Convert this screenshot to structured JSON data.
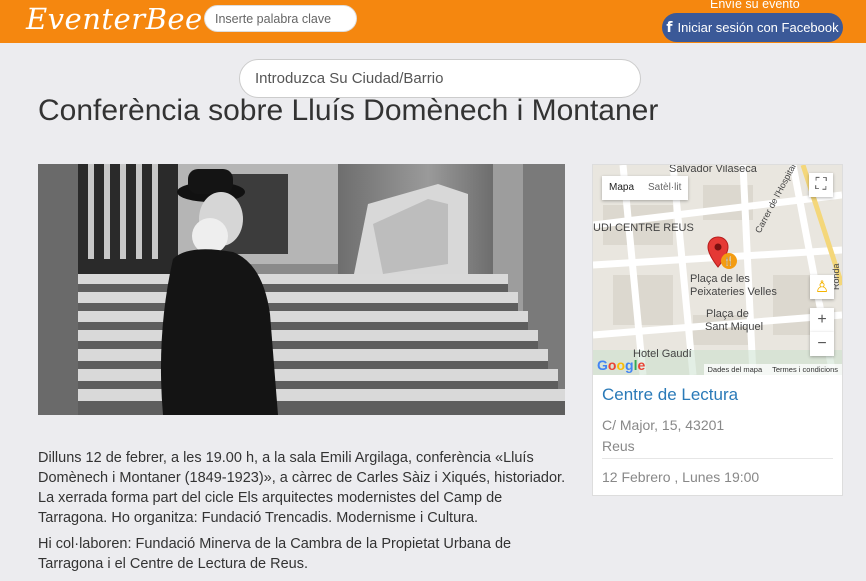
{
  "header": {
    "logo": "EventerBee",
    "keyword_placeholder": "Inserte palabra clave",
    "submit_event": "Envíe su evento",
    "facebook_login": "Iniciar sesión con Facebook",
    "facebook_icon": "f",
    "brand_color": "#f5870f",
    "facebook_color": "#3b5998"
  },
  "city_search": {
    "placeholder": "Introduzca Su Ciudad/Barrio"
  },
  "event": {
    "title": "Conferència sobre Lluís Domènech i Montaner",
    "description_1": "Dilluns 12 de febrer, a les 19.00 h, a la sala Emili Argilaga, conferència «Lluís Domènech i Montaner (1849-1923)», a càrrec de Carles Sàiz i Xiqués, historiador. La xerrada forma part del cicle Els arquitectes modernistes del Camp de Tarragona. Ho organitza: Fundació Trencadis. Modernisme i Cultura.",
    "description_2": "Hi col·laboren: Fundació Minerva de la Cambra de la Propietat Urbana de Tarragona i el Centre de Lectura de Reus."
  },
  "map": {
    "type_map": "Mapa",
    "type_satellite": "Satèl·lit",
    "labels": {
      "salvador": "Salvador Vilaseca",
      "centre_reus": "UDI CENTRE REUS",
      "carrer_hospital": "Carrer de l'Hospital",
      "placa_peix_1": "Plaça de les",
      "placa_peix_2": "Peixateries Velles",
      "placa_sm_1": "Plaça de",
      "placa_sm_2": "Sant Miquel",
      "hotel": "Hotel Gaudí",
      "edge_label": "Ronda"
    },
    "google": "Google",
    "map_data": "Dades del mapa",
    "terms": "Termes i condicions",
    "zoom_in": "+",
    "zoom_out": "−"
  },
  "venue": {
    "name": "Centre de Lectura",
    "address_line": "C/ Major, 15, 43201",
    "city": "Reus",
    "datetime": "12 Febrero , Lunes 19:00"
  }
}
